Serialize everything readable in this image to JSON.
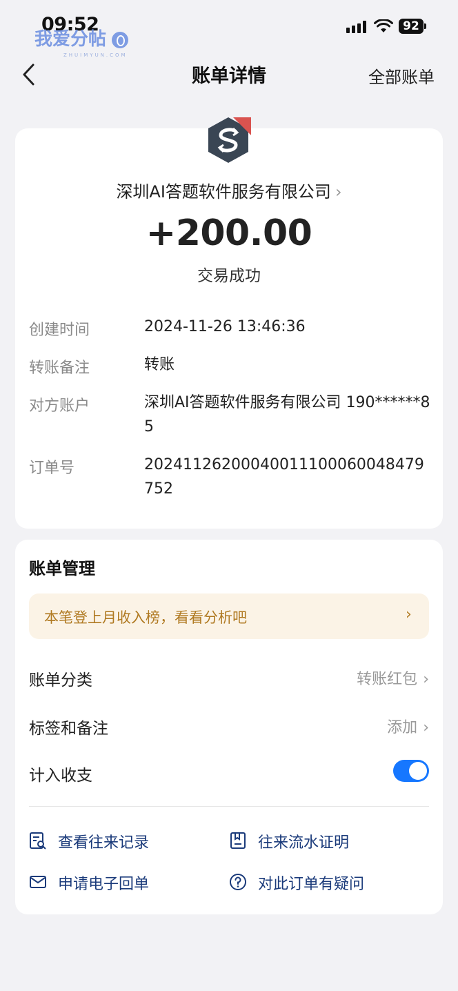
{
  "status_bar": {
    "time": "09:52",
    "battery": "92"
  },
  "watermark": {
    "text": "我爱分帖",
    "sub": "ZHUIMYUN.COM"
  },
  "nav": {
    "title": "账单详情",
    "right": "全部账单"
  },
  "transaction": {
    "merchant": "深圳AI答题软件服务有限公司",
    "amount": "+200.00",
    "status": "交易成功"
  },
  "details": [
    {
      "label": "创建时间",
      "value": "2024-11-26 13:46:36"
    },
    {
      "label": "转账备注",
      "value": "转账"
    },
    {
      "label": "对方账户",
      "value": "深圳AI答题软件服务有限公司 190******85"
    },
    {
      "label": "订单号",
      "value": "20241126200040011100060048479752"
    }
  ],
  "management": {
    "title": "账单管理",
    "promo": "本笔登上月收入榜，看看分析吧",
    "category_label": "账单分类",
    "category_value": "转账红包",
    "tags_label": "标签和备注",
    "tags_value": "添加",
    "count_label": "计入收支",
    "count_enabled": true
  },
  "actions": {
    "view_records": "查看往来记录",
    "statement": "往来流水证明",
    "receipt": "申请电子回单",
    "question": "对此订单有疑问"
  }
}
